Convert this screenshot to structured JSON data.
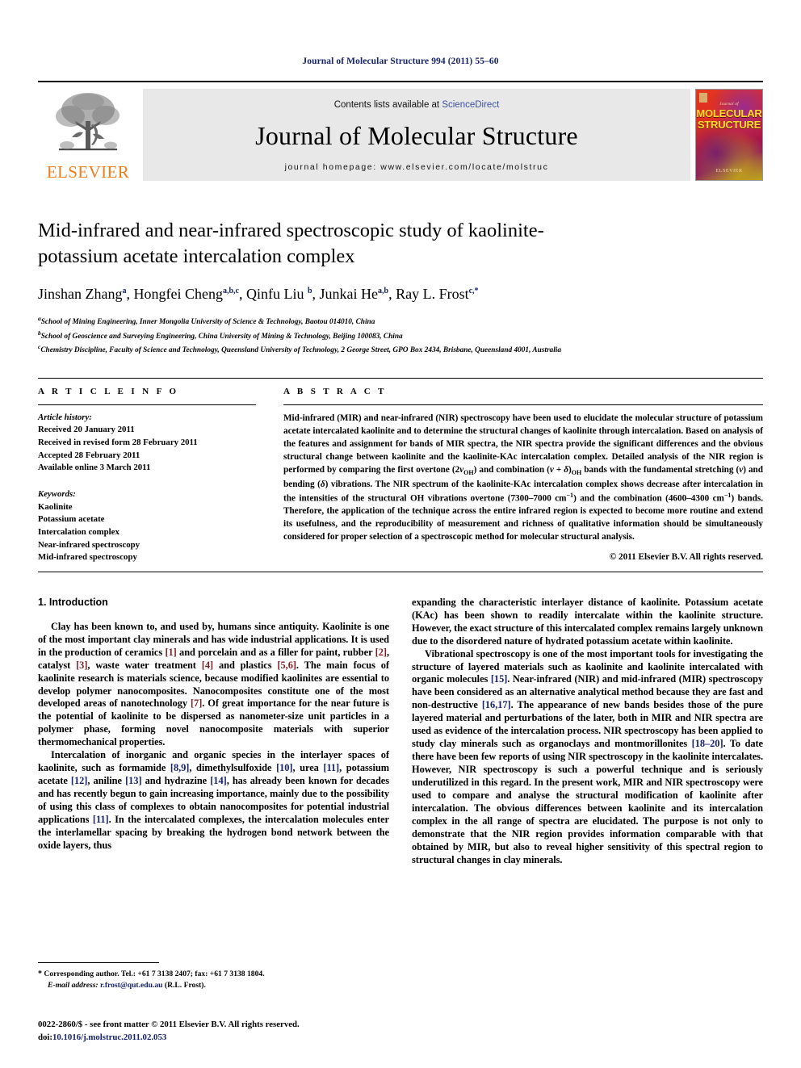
{
  "running_head": "Journal of Molecular Structure 994 (2011) 55–60",
  "masthead": {
    "publisher_name": "ELSEVIER",
    "contents_prefix": "Contents lists available at ",
    "contents_link": "ScienceDirect",
    "journal_title": "Journal of Molecular Structure",
    "homepage": "journal homepage: www.elsevier.com/locate/molstruc",
    "cover": {
      "small_line": "Journal of",
      "line1": "MOLECULAR",
      "line2": "STRUCTURE",
      "publisher": "ELSEVIER"
    }
  },
  "title": "Mid-infrared and near-infrared spectroscopic study of kaolinite-potassium acetate intercalation complex",
  "authors": [
    {
      "name": "Jinshan Zhang",
      "sup": "a"
    },
    {
      "name": "Hongfei Cheng",
      "sup": "a,b,c"
    },
    {
      "name": "Qinfu Liu",
      "sup": "b"
    },
    {
      "name": "Junkai He",
      "sup": "a,b"
    },
    {
      "name": "Ray L. Frost",
      "sup": "c,*"
    }
  ],
  "affiliations": [
    {
      "mark": "a",
      "text": "School of Mining Engineering, Inner Mongolia University of Science & Technology, Baotou 014010, China"
    },
    {
      "mark": "b",
      "text": "School of Geoscience and Surveying Engineering, China University of Mining & Technology, Beijing 100083, China"
    },
    {
      "mark": "c",
      "text": "Chemistry Discipline, Faculty of Science and Technology, Queensland University of Technology, 2 George Street, GPO Box 2434, Brisbane, Queensland 4001, Australia"
    }
  ],
  "article_info": {
    "heading": "A R T I C L E   I N F O",
    "history_label": "Article history:",
    "history": [
      "Received 20 January 2011",
      "Received in revised form 28 February 2011",
      "Accepted 28 February 2011",
      "Available online 3 March 2011"
    ],
    "keywords_label": "Keywords:",
    "keywords": [
      "Kaolinite",
      "Potassium acetate",
      "Intercalation complex",
      "Near-infrared spectroscopy",
      "Mid-infrared spectroscopy"
    ]
  },
  "abstract": {
    "heading": "A B S T R A C T",
    "part1": "Mid-infrared (MIR) and near-infrared (NIR) spectroscopy have been used to elucidate the molecular structure of potassium acetate intercalated kaolinite and to determine the structural changes of kaolinite through intercalation. Based on analysis of the features and assignment for bands of MIR spectra, the NIR spectra provide the significant differences and the obvious structural change between kaolinite and the kaolinite-KAc intercalation complex. Detailed analysis of the NIR region is performed by comparing the first overtone (2",
    "nu1": "v",
    "sub1": "OH",
    "part2": ") and combination (",
    "nu2": "v",
    "plus": " + ",
    "delta1": "δ",
    "sub2": "OH",
    "part3": " bands with the fundamental stretching (",
    "nu3": "v",
    "part4": ") and bending (",
    "delta2": "δ",
    "part5": ") vibrations. The NIR spectrum of the kaolinite-KAc intercalation complex shows decrease after intercalation in the intensities of the structural OH vibrations overtone (7300–7000 cm",
    "sup1": "−1",
    "part6": ") and the combination (4600–4300 cm",
    "sup2": "−1",
    "part7": ") bands. Therefore, the application of the technique across the entire infrared region is expected to become more routine and extend its usefulness, and the reproducibility of measurement and richness of qualitative information should be simultaneously considered for proper selection of a spectroscopic method for molecular structural analysis.",
    "copyright": "© 2011 Elsevier B.V. All rights reserved."
  },
  "introduction": {
    "heading": "1. Introduction",
    "left_paragraphs": [
      {
        "segments": [
          {
            "t": "Clay has been known to, and used by, humans since antiquity. Kaolinite is one of the most important clay minerals and has wide industrial applications. It is used in the production of ceramics "
          },
          {
            "t": "[1]",
            "c": "ref"
          },
          {
            "t": " and porcelain and as a filler for paint, rubber "
          },
          {
            "t": "[2]",
            "c": "ref"
          },
          {
            "t": ", catalyst "
          },
          {
            "t": "[3]",
            "c": "ref"
          },
          {
            "t": ", waste water treatment "
          },
          {
            "t": "[4]",
            "c": "ref"
          },
          {
            "t": " and plastics "
          },
          {
            "t": "[5,6]",
            "c": "ref"
          },
          {
            "t": ". The main focus of kaolinite research is materials science, because modified kaolinites are essential to develop polymer nanocomposites. Nanocomposites constitute one of the most developed areas of nanotechnology "
          },
          {
            "t": "[7]",
            "c": "ref"
          },
          {
            "t": ". Of great importance for the near future is the potential of kaolinite to be dispersed as nanometer-size unit particles in a polymer phase, forming novel nanocomposite materials with superior thermomechanical properties."
          }
        ]
      },
      {
        "segments": [
          {
            "t": "Intercalation of inorganic and organic species in the interlayer spaces of kaolinite, such as formamide "
          },
          {
            "t": "[8,9]",
            "c": "refb"
          },
          {
            "t": ", dimethylsulfoxide "
          },
          {
            "t": "[10]",
            "c": "refb"
          },
          {
            "t": ", urea "
          },
          {
            "t": "[11]",
            "c": "refb"
          },
          {
            "t": ", potassium acetate "
          },
          {
            "t": "[12]",
            "c": "refb"
          },
          {
            "t": ", aniline "
          },
          {
            "t": "[13]",
            "c": "refb"
          },
          {
            "t": " and hydrazine "
          },
          {
            "t": "[14]",
            "c": "refb"
          },
          {
            "t": ", has already been known for decades and has recently begun to gain increasing importance, mainly due to the possibility of using this class of complexes to obtain nanocomposites for potential industrial applications "
          },
          {
            "t": "[11]",
            "c": "refb"
          },
          {
            "t": ". In the intercalated complexes, the intercalation molecules enter the interlamellar spacing by breaking the hydrogen bond network between the oxide layers, thus"
          }
        ]
      }
    ],
    "right_paragraphs": [
      {
        "segments": [
          {
            "t": "expanding the characteristic interlayer distance of kaolinite. Potassium acetate (KAc) has been shown to readily intercalate within the kaolinite structure. However, the exact structure of this intercalated complex remains largely unknown due to the disordered nature of hydrated potassium acetate within kaolinite."
          }
        ],
        "no_indent": true
      },
      {
        "segments": [
          {
            "t": "Vibrational spectroscopy is one of the most important tools for investigating the structure of layered materials such as kaolinite and kaolinite intercalated with organic molecules "
          },
          {
            "t": "[15]",
            "c": "refb"
          },
          {
            "t": ". Near-infrared (NIR) and mid-infrared (MIR) spectroscopy have been considered as an alternative analytical method because they are fast and non-destructive "
          },
          {
            "t": "[16,17]",
            "c": "refb"
          },
          {
            "t": ". The appearance of new bands besides those of the pure layered material and perturbations of the later, both in MIR and NIR spectra are used as evidence of the intercalation process. NIR spectroscopy has been applied to study clay minerals such as organoclays and montmorillonites "
          },
          {
            "t": "[18–20]",
            "c": "refb"
          },
          {
            "t": ". To date there have been few reports of using NIR spectroscopy in the kaolinite intercalates. However, NIR spectroscopy is such a powerful technique and is seriously underutilized in this regard. In the present work, MIR and NIR spectroscopy were used to compare and analyse the structural modification of kaolinite after intercalation. The obvious differences between kaolinite and its intercalation complex in the all range of spectra are elucidated. The purpose is not only to demonstrate that the NIR region provides information comparable with that obtained by MIR, but also to reveal higher sensitivity of this spectral region to structural changes in clay minerals."
          }
        ]
      }
    ]
  },
  "footnote": {
    "star": "*",
    "corresponding": "Corresponding author. Tel.: +61 7 3138 2407; fax: +61 7 3138 1804.",
    "email_label": "E-mail address:",
    "email": "r.frost@qut.edu.au",
    "email_person": "(R.L. Frost)."
  },
  "issn_line": "0022-2860/$ - see front matter © 2011 Elsevier B.V. All rights reserved.",
  "doi_label": "doi:",
  "doi": "10.1016/j.molstruc.2011.02.053",
  "colors": {
    "running_head": "#16226b",
    "elsevier_orange": "#ef7d1a",
    "science_direct": "#3b4fa4",
    "ref_red": "#7c1f26",
    "ref_blue": "#16226b",
    "band_gray": "#e8e8e8"
  }
}
